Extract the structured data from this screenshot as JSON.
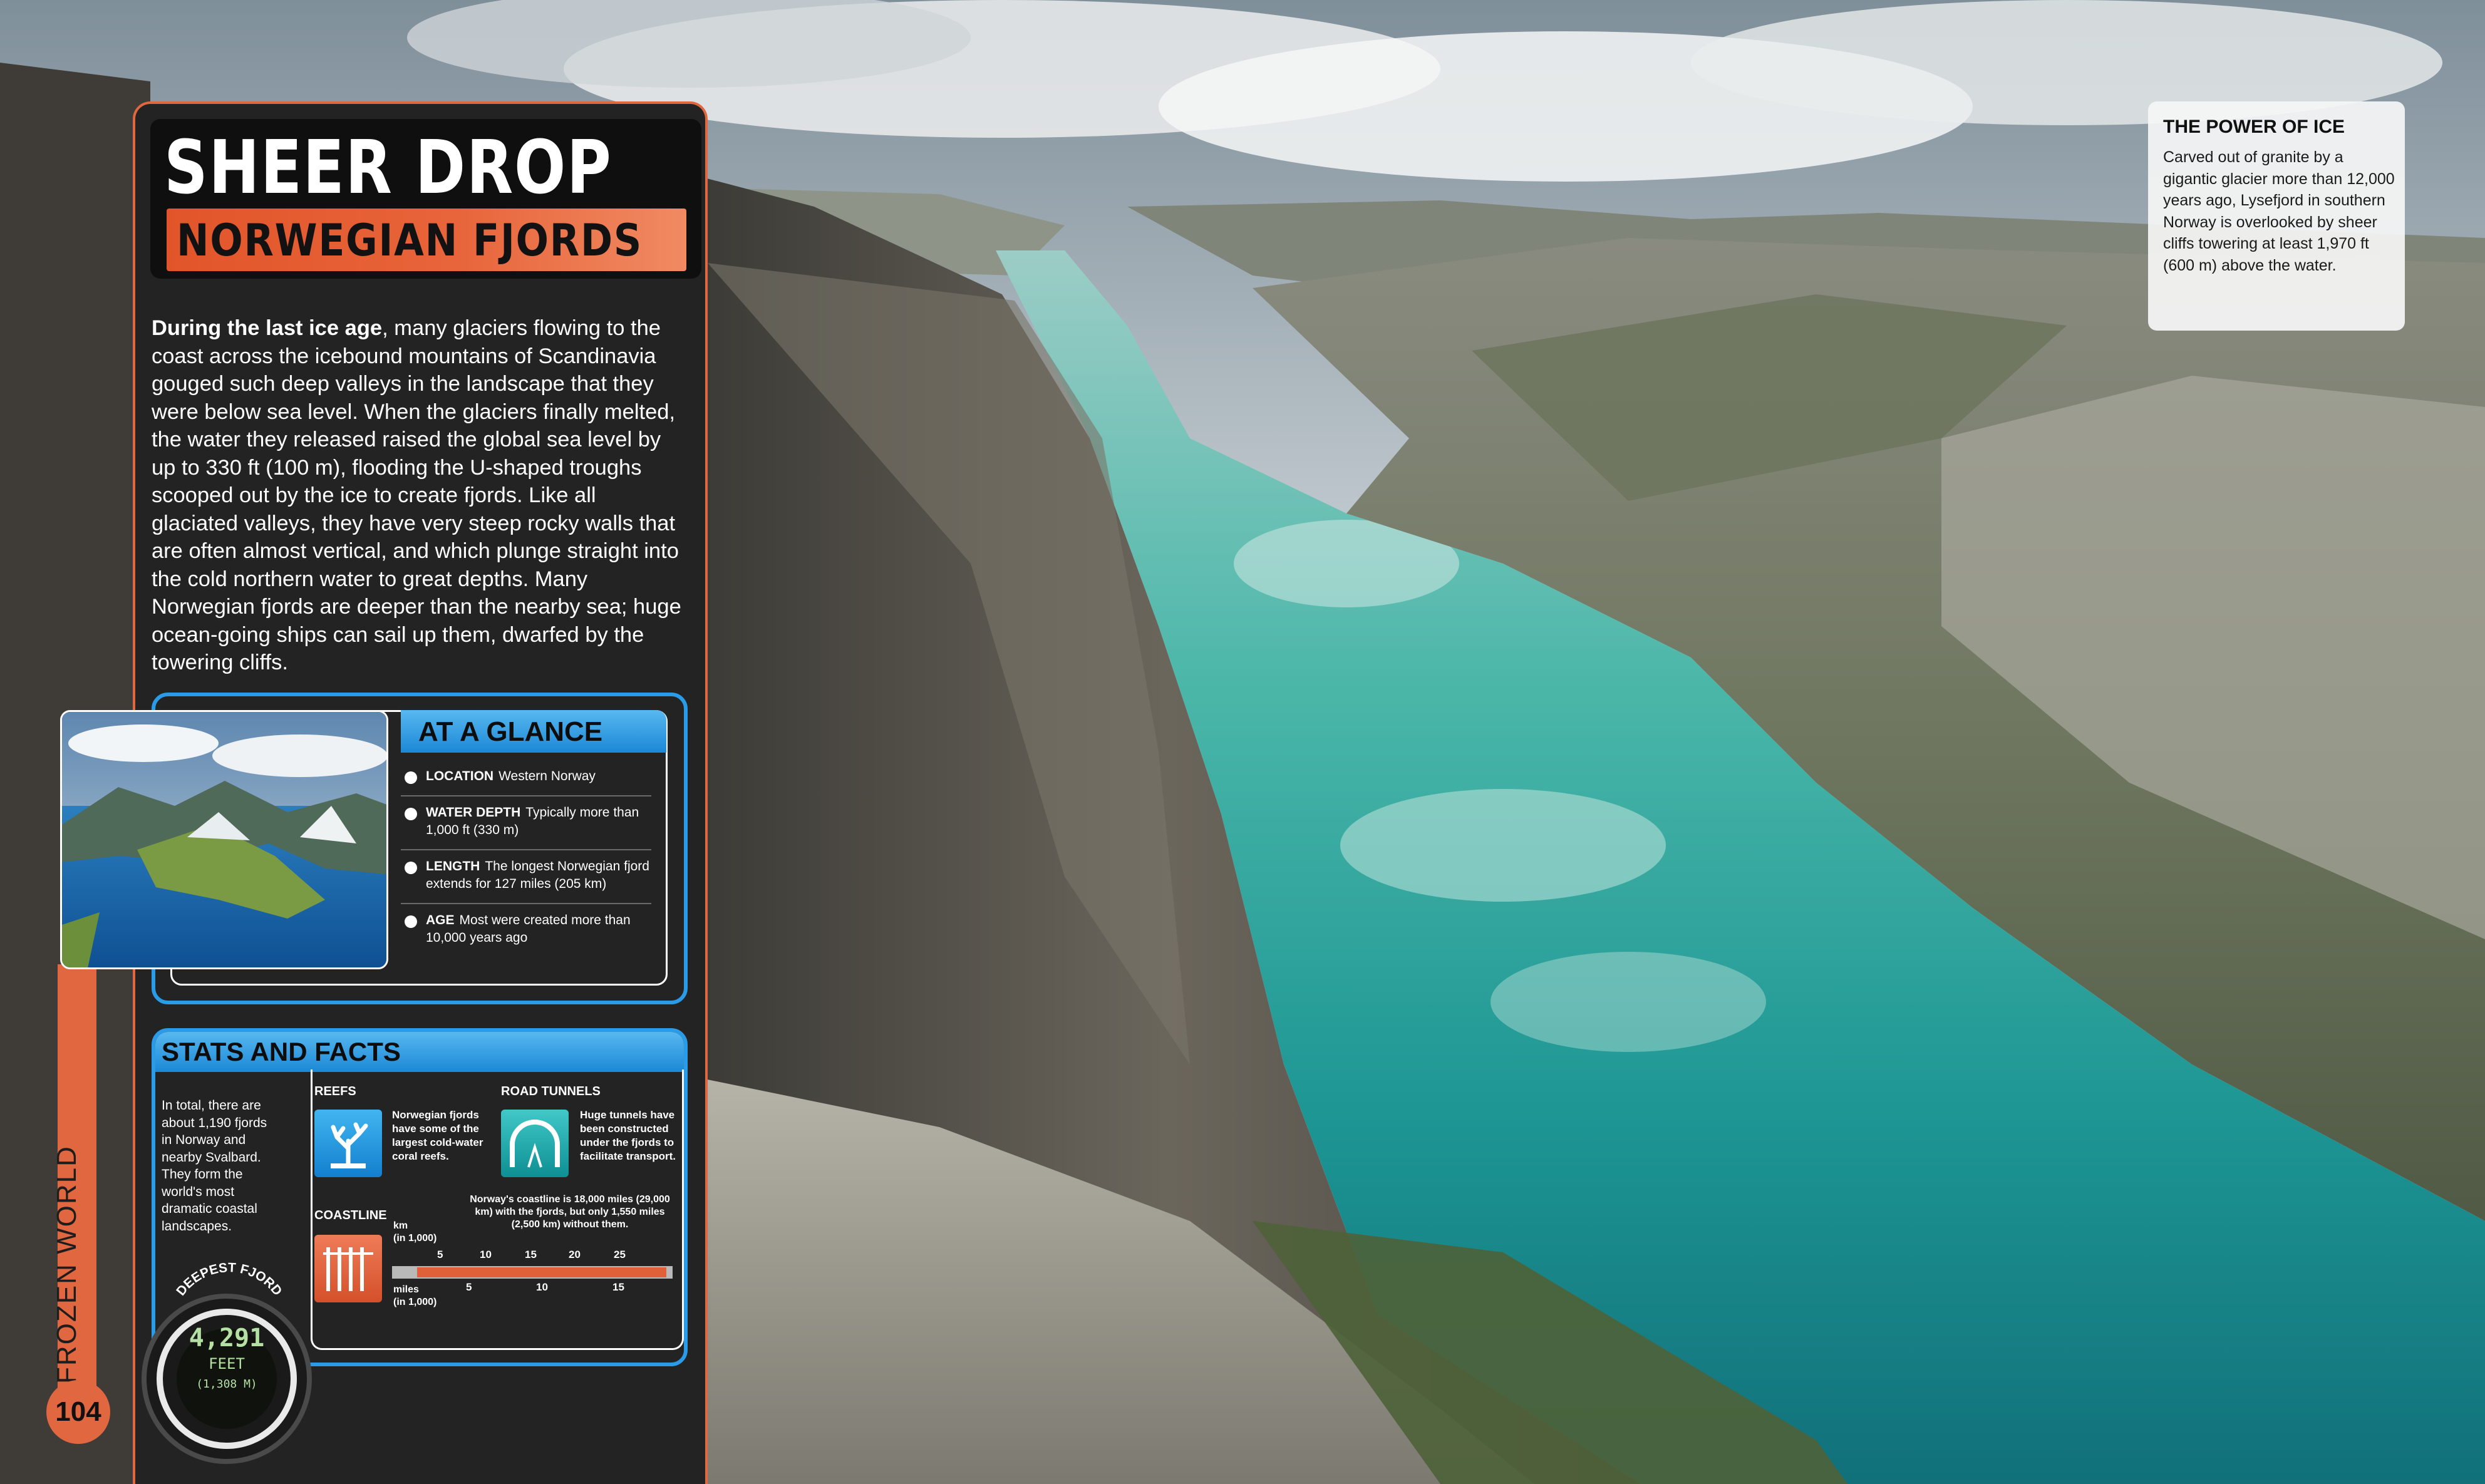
{
  "header": {
    "title": "SHEER DROP",
    "subtitle": "NORWEGIAN FJORDS"
  },
  "intro": {
    "lead": "During the last ice age",
    "body": ", many glaciers flowing to the coast across the icebound mountains of Scandinavia gouged such deep valleys in the landscape that they were below sea level. When the glaciers finally melted, the water they released raised the global sea level by up to 330 ft (100 m), flooding the U-shaped troughs scooped out by the ice to create fjords. Like all glaciated valleys, they have very steep rocky walls that are often almost vertical, and which plunge straight into the cold northern water to great depths. Many Norwegian fjords are deeper than the nearby sea; huge ocean-going ships can sail up them, dwarfed by the towering cliffs."
  },
  "side_tab": {
    "label": "FROZEN WORLD",
    "page_number": "104"
  },
  "at_a_glance": {
    "heading": "AT A GLANCE",
    "facts": [
      {
        "label": "LOCATION",
        "text": "Western Norway"
      },
      {
        "label": "WATER DEPTH",
        "text": "Typically more than 1,000 ft (330 m)"
      },
      {
        "label": "LENGTH",
        "text": "The longest Norwegian fjord extends for 127 miles (205 km)"
      },
      {
        "label": "AGE",
        "text": "Most were created more than 10,000 years ago"
      }
    ]
  },
  "stats": {
    "heading": "STATS AND FACTS",
    "intro": "In total, there are about 1,190 fjords in Norway and nearby Svalbard. They form the world's most dramatic coastal landscapes.",
    "reefs": {
      "label": "REEFS",
      "text": "Norwegian fjords have some of the largest cold-water coral reefs."
    },
    "road_tunnels": {
      "label": "ROAD TUNNELS",
      "text": "Huge tunnels have been constructed under the fjords to facilitate transport."
    },
    "coastline": {
      "label": "COASTLINE",
      "note": "Norway's coastline is 18,000 miles (29,000 km) with the fjords, but only 1,550 miles (2,500 km) without them.",
      "km_unit": "km",
      "km_scale": "(in 1,000)",
      "km_ticks": [
        "5",
        "10",
        "15",
        "20",
        "25"
      ],
      "miles_unit": "miles",
      "miles_scale": "(in 1,000)",
      "miles_ticks": [
        "5",
        "10",
        "15"
      ],
      "with_fjords_km_thousands": 29,
      "without_fjords_km_thousands": 2.5
    },
    "deepest_fjord": {
      "label": "DEEPEST FJORD",
      "value": "4,291",
      "unit": "FEET",
      "metric": "(1,308 M)"
    }
  },
  "power_of_ice": {
    "title": "THE POWER OF ICE",
    "text": "Carved out of granite by a gigantic glacier more than 12,000 years ago, Lysefjord in southern Norway is overlooked by sheer cliffs towering at least 1,970 ft (600 m) above the water."
  },
  "colors": {
    "accent_orange": "#e0673f",
    "accent_blue": "#2a9be6",
    "panel_dark": "#232323",
    "fjord_water": "#1f9b95"
  }
}
